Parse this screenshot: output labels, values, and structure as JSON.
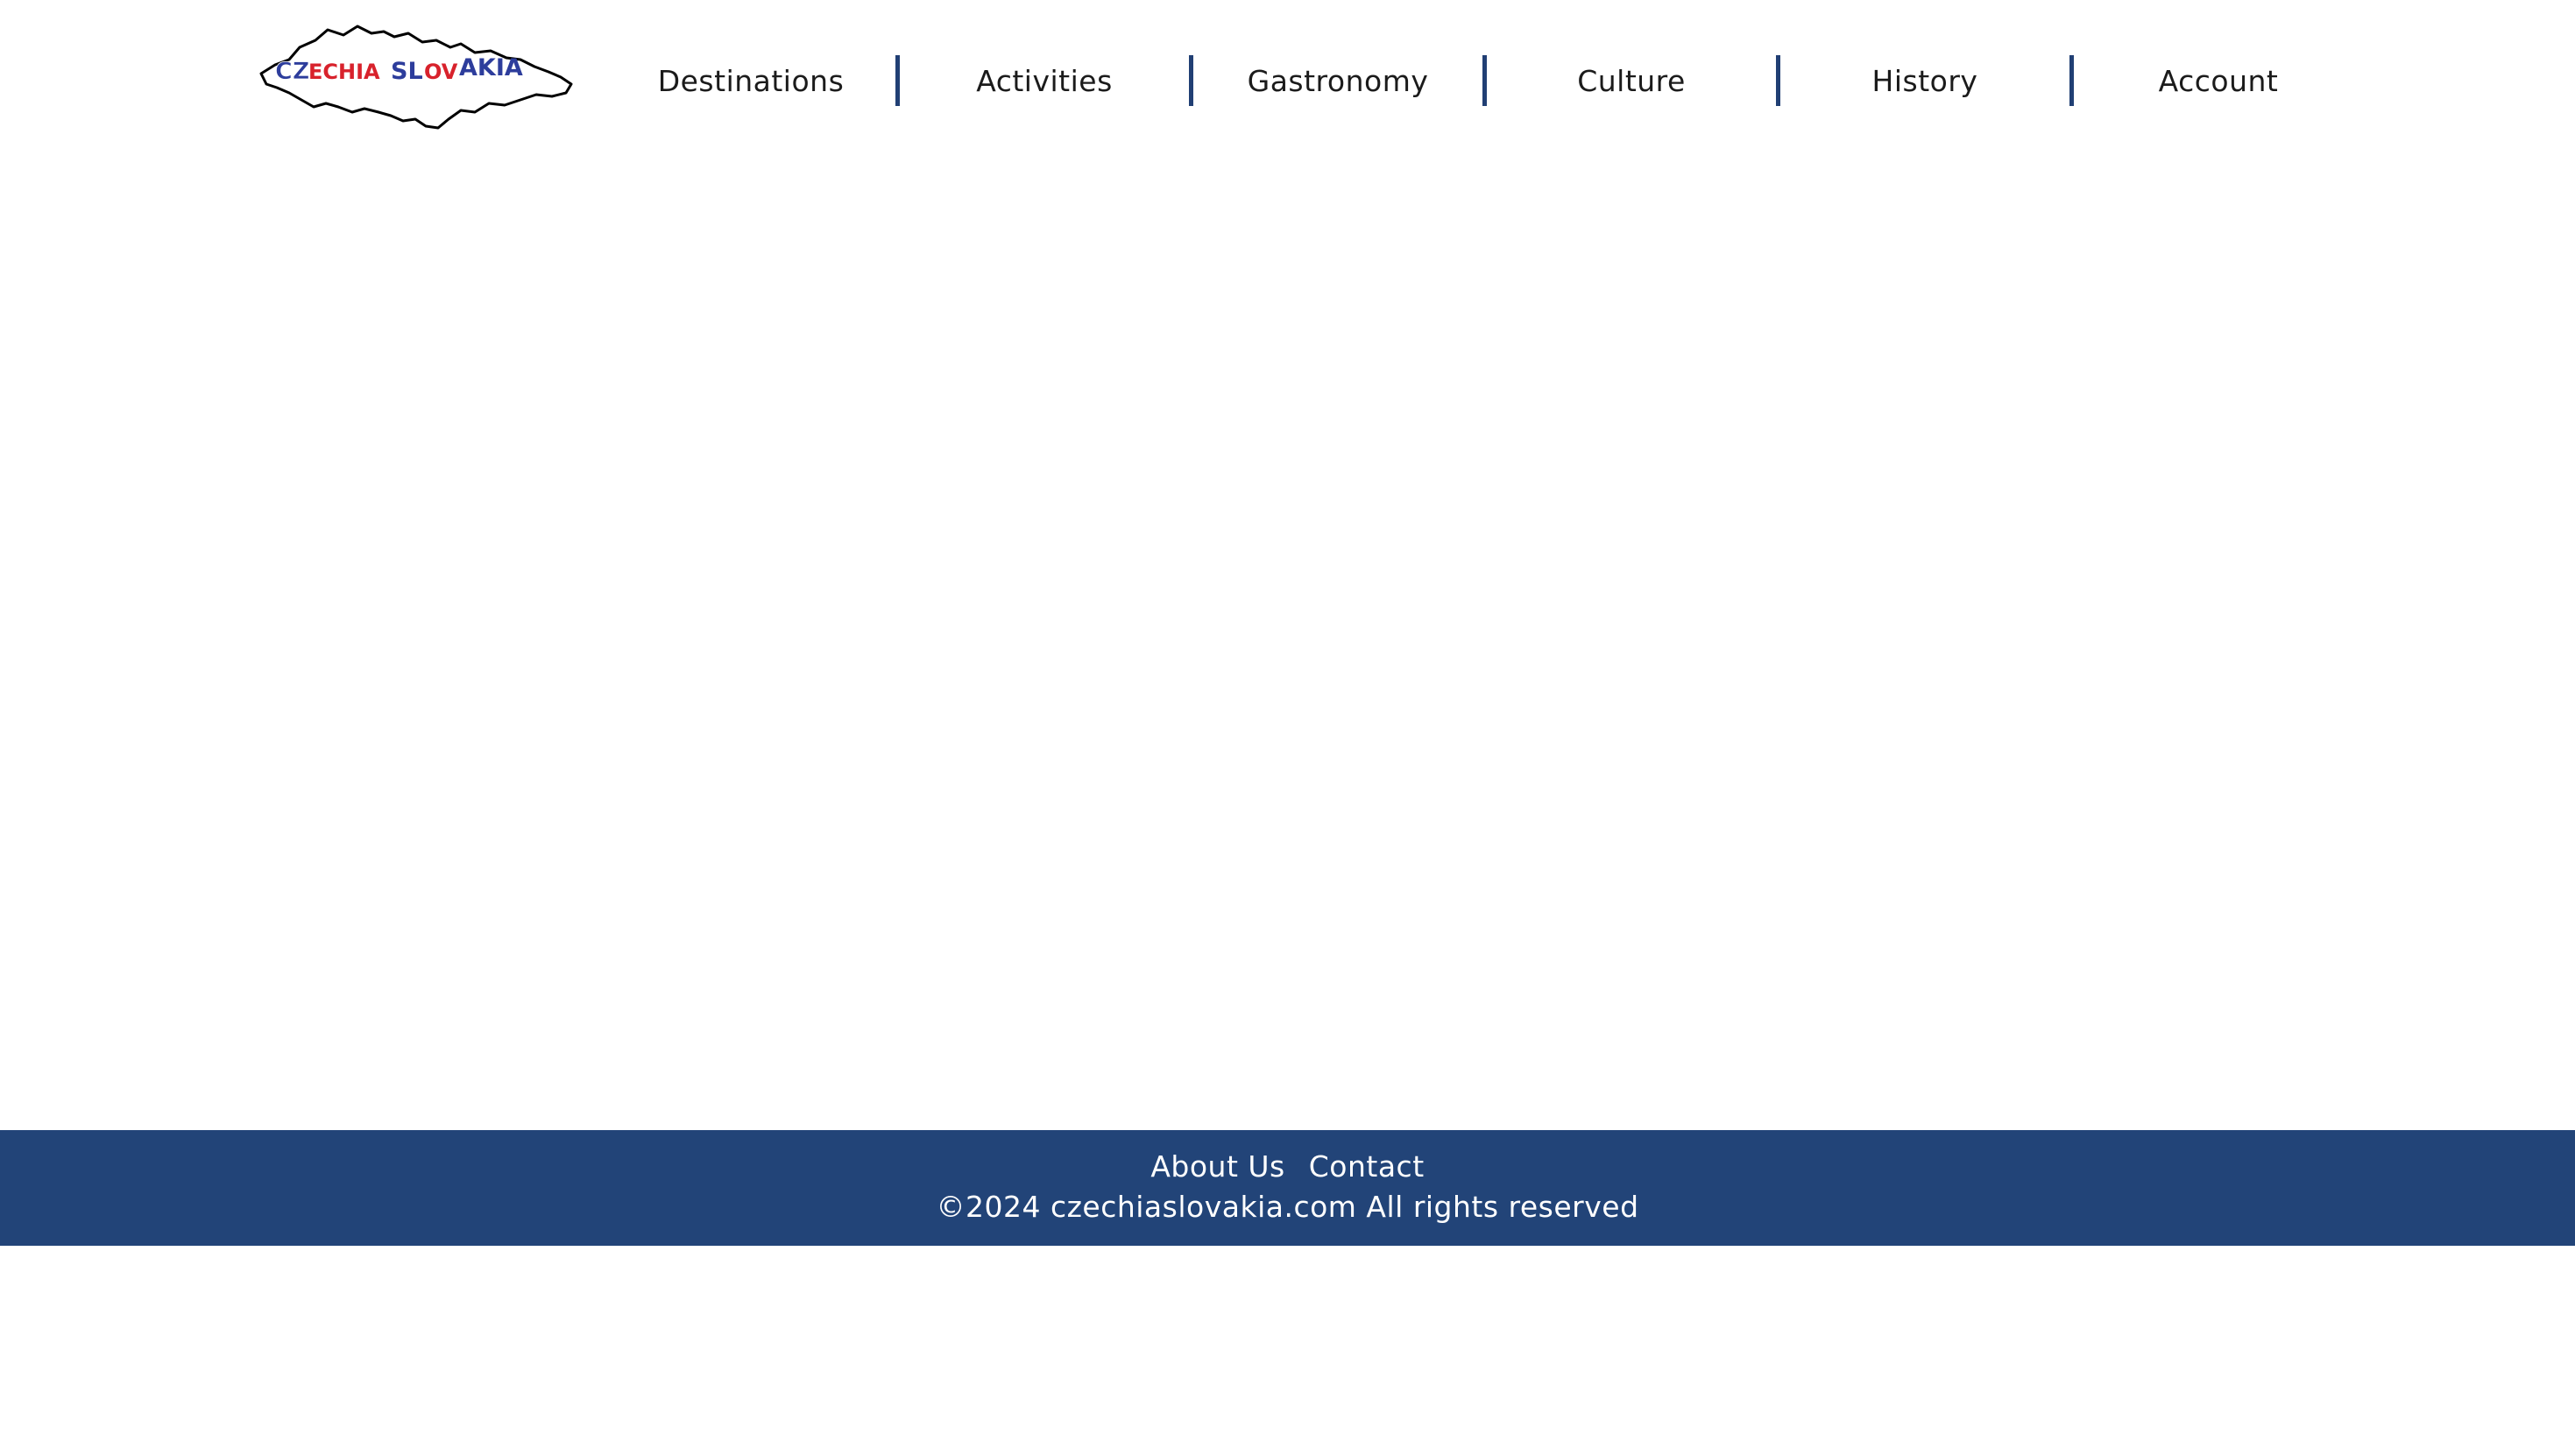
{
  "header": {
    "logo": {
      "text_parts": [
        "CZECHIA",
        "SLOVAKIA"
      ],
      "colors": {
        "outline": "#000000",
        "blue": "#2d3d9c",
        "red": "#d8222c",
        "white": "#ffffff"
      }
    },
    "nav": [
      {
        "label": "Destinations"
      },
      {
        "label": "Activities"
      },
      {
        "label": "Gastronomy"
      },
      {
        "label": "Culture"
      },
      {
        "label": "History"
      },
      {
        "label": "Account"
      }
    ],
    "separator_color": "#213f74"
  },
  "footer": {
    "background": "#224478",
    "links": [
      {
        "label": "About Us"
      },
      {
        "label": "Contact"
      }
    ],
    "copyright": "©2024 czechiaslovakia.com All rights reserved"
  }
}
